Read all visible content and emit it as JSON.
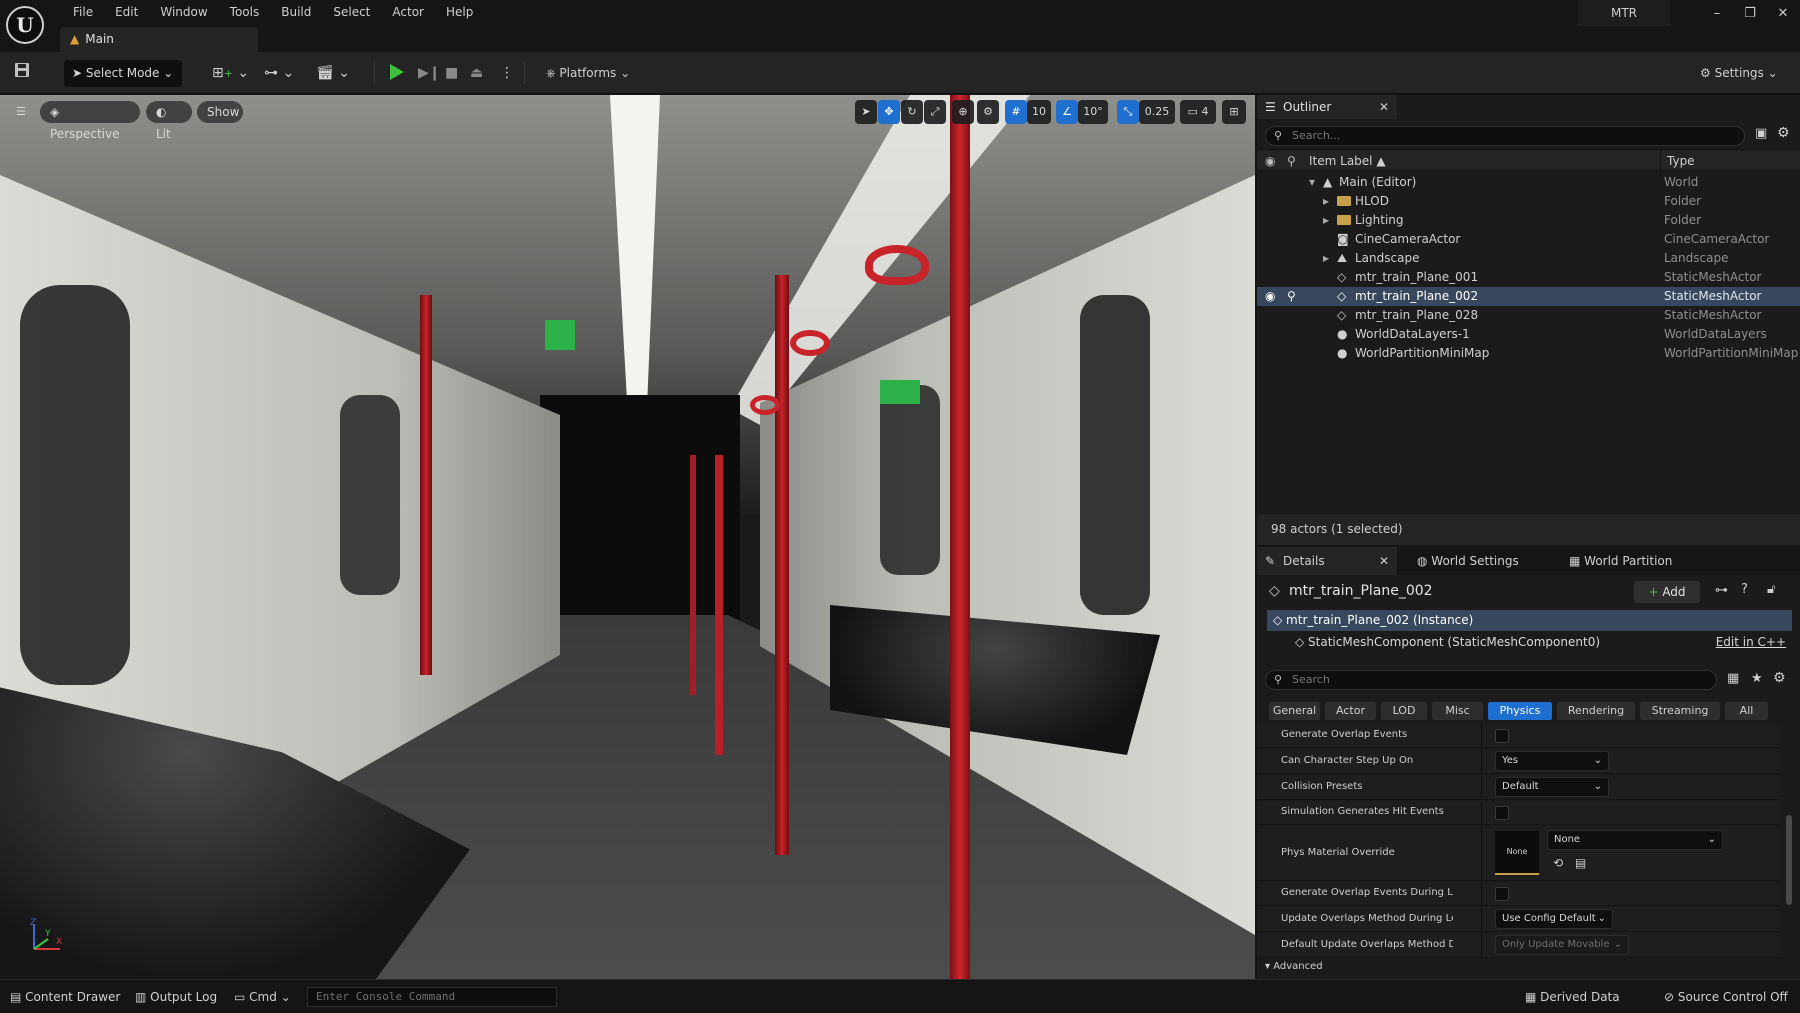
{
  "menubar": {
    "logo": "U",
    "items": [
      "File",
      "Edit",
      "Window",
      "Tools",
      "Build",
      "Select",
      "Actor",
      "Help"
    ],
    "doc_tab": "Main",
    "project": "MTR",
    "window_controls": [
      "–",
      "❐",
      "✕"
    ]
  },
  "toolbar": {
    "select_mode": "Select Mode",
    "platforms": "Platforms",
    "settings": "Settings"
  },
  "viewport": {
    "perspective": "Perspective",
    "lit": "Lit",
    "show": "Show",
    "grid_snap": "10",
    "rot_snap": "10°",
    "scale_snap": "0.25",
    "camera_speed": "4",
    "axis_x": "X",
    "axis_y": "Y",
    "axis_z": "Z"
  },
  "outliner": {
    "tab_label": "Outliner",
    "search_placeholder": "Search...",
    "col_label": "Item Label ▲",
    "col_type": "Type",
    "rows": [
      {
        "label": "Main (Editor)",
        "type": "World"
      },
      {
        "label": "HLOD",
        "type": "Folder"
      },
      {
        "label": "Lighting",
        "type": "Folder"
      },
      {
        "label": "CineCameraActor",
        "type": "CineCameraActor"
      },
      {
        "label": "Landscape",
        "type": "Landscape"
      },
      {
        "label": "mtr_train_Plane_001",
        "type": "StaticMeshActor"
      },
      {
        "label": "mtr_train_Plane_002",
        "type": "StaticMeshActor"
      },
      {
        "label": "mtr_train_Plane_028",
        "type": "StaticMeshActor"
      },
      {
        "label": "WorldDataLayers-1",
        "type": "WorldDataLayers"
      },
      {
        "label": "WorldPartitionMiniMap",
        "type": "WorldPartitionMiniMap"
      }
    ],
    "count": "98 actors (1 selected)"
  },
  "details": {
    "tabs": [
      "Details",
      "World Settings",
      "World Partition"
    ],
    "object_name": "mtr_train_Plane_002",
    "add_label": "Add",
    "instance_row": "mtr_train_Plane_002 (Instance)",
    "component_row": "StaticMeshComponent (StaticMeshComponent0)",
    "edit_cpp": "Edit in C++",
    "search_placeholder": "Search",
    "filters": [
      "General",
      "Actor",
      "LOD",
      "Misc",
      "Physics",
      "Rendering",
      "Streaming",
      "All"
    ],
    "props": {
      "generate_overlap": "Generate Overlap Events",
      "step_up": "Can Character Step Up On",
      "step_up_value": "Yes",
      "collision_presets": "Collision Presets",
      "collision_value": "Default",
      "sim_hit": "Simulation Generates Hit Events",
      "phys_material": "Phys Material Override",
      "phys_thumb": "None",
      "phys_value": "None",
      "overlap_level": "Generate Overlap Events During Level St...",
      "update_overlaps": "Update Overlaps Method During Level St...",
      "update_overlaps_value": "Use Config Default",
      "default_update": "Default Update Overlaps Method During...",
      "default_update_value": "Only Update Movable",
      "advanced": "Advanced"
    }
  },
  "statusbar": {
    "content_drawer": "Content Drawer",
    "output_log": "Output Log",
    "cmd": "Cmd",
    "console_placeholder": "Enter Console Command",
    "derived_data": "Derived Data",
    "source_control": "Source Control Off"
  }
}
